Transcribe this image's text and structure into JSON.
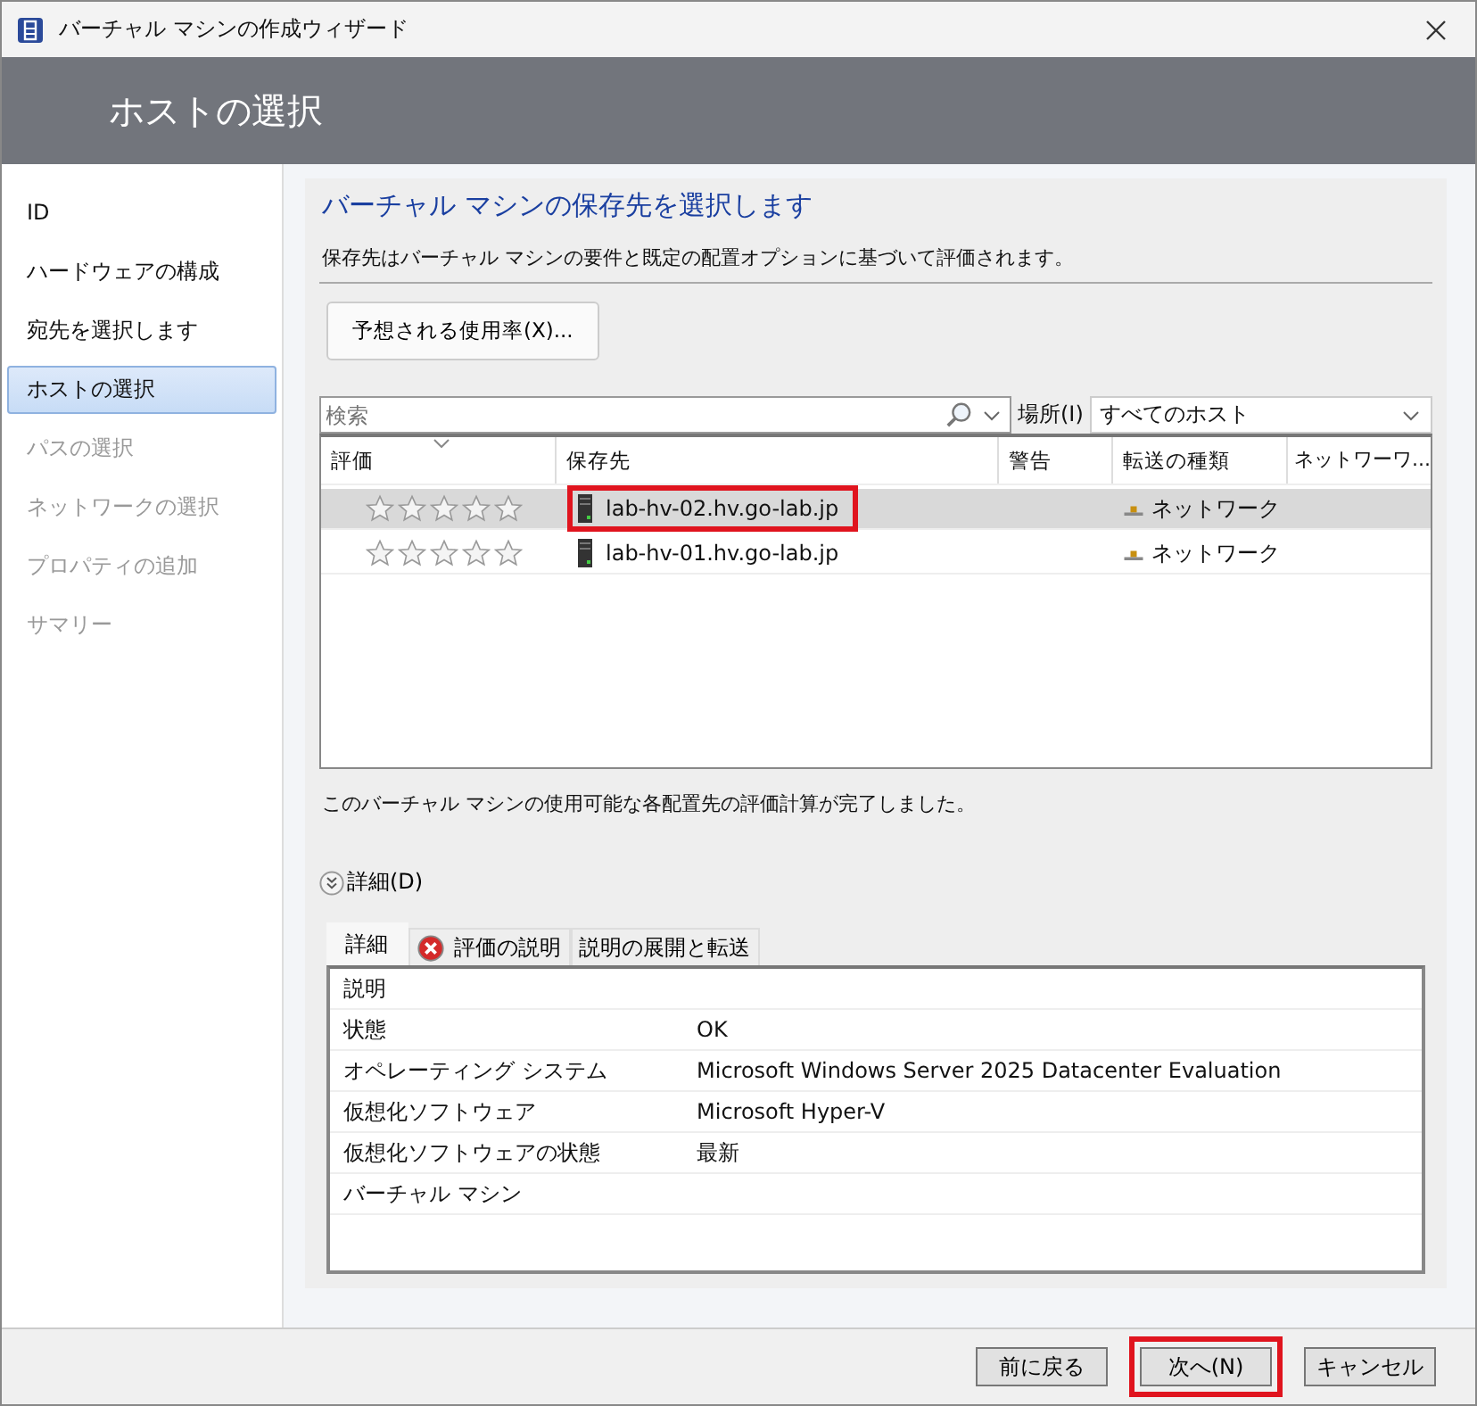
{
  "window": {
    "title": "バーチャル マシンの作成ウィザード"
  },
  "header": {
    "title": "ホストの選択"
  },
  "sidebar": {
    "items": [
      {
        "label": "ID",
        "selected": false,
        "disabled": false
      },
      {
        "label": "ハードウェアの構成",
        "selected": false,
        "disabled": false
      },
      {
        "label": "宛先を選択します",
        "selected": false,
        "disabled": false
      },
      {
        "label": "ホストの選択",
        "selected": true,
        "disabled": false
      },
      {
        "label": "パスの選択",
        "selected": false,
        "disabled": true
      },
      {
        "label": "ネットワークの選択",
        "selected": false,
        "disabled": true
      },
      {
        "label": "プロパティの追加",
        "selected": false,
        "disabled": true
      },
      {
        "label": "サマリー",
        "selected": false,
        "disabled": true
      }
    ]
  },
  "page": {
    "heading": "バーチャル マシンの保存先を選択します",
    "description": "保存先はバーチャル マシンの要件と既定の配置オプションに基づいて評価されます。",
    "usage_button": "予想される使用率(X)...",
    "search": {
      "placeholder": "検索"
    },
    "location_label": "場所(I)",
    "location_value": "すべてのホスト"
  },
  "table": {
    "columns": [
      "評価",
      "保存先",
      "警告",
      "転送の種類",
      "ネットワーワ..."
    ],
    "rows": [
      {
        "stars": 0,
        "destination": "lab-hv-02.hv.go-lab.jp",
        "transfer": "ネットワーク",
        "selected": true,
        "highlighted": true
      },
      {
        "stars": 0,
        "destination": "lab-hv-01.hv.go-lab.jp",
        "transfer": "ネットワーク",
        "selected": false,
        "highlighted": false
      }
    ]
  },
  "status_message": "このバーチャル マシンの使用可能な各配置先の評価計算が完了しました。",
  "details_toggle": {
    "label": "詳細(D)",
    "expanded": true
  },
  "detail_tabs": [
    {
      "label": "詳細",
      "selected": true,
      "error": false
    },
    {
      "label": "評価の説明",
      "selected": false,
      "error": true
    },
    {
      "label": "説明の展開と転送",
      "selected": false,
      "error": false
    }
  ],
  "details": [
    {
      "label": "説明"
    },
    {
      "label": "状態",
      "value": "OK"
    },
    {
      "label": "オペレーティング システム",
      "value": "Microsoft Windows Server 2025 Datacenter Evaluation"
    },
    {
      "label": "仮想化ソフトウェア",
      "value": "Microsoft Hyper-V"
    },
    {
      "label": "仮想化ソフトウェアの状態",
      "value": "最新"
    },
    {
      "label": "バーチャル マシン"
    }
  ],
  "buttons": [
    {
      "label": "前に戻る",
      "highlighted": false
    },
    {
      "label": "次へ(N)",
      "highlighted": true
    },
    {
      "label": "キャンセル",
      "highlighted": false
    }
  ]
}
